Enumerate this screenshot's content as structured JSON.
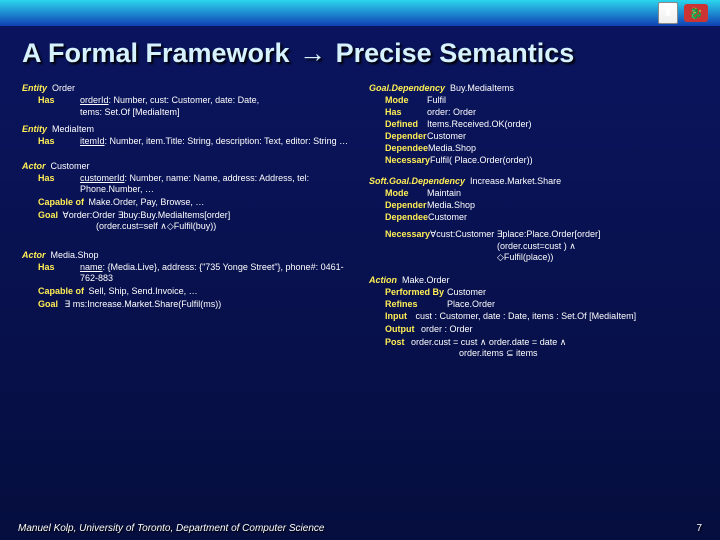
{
  "header": {
    "title_before": "A Formal Framework",
    "arrow": "→",
    "title_after": "Precise Semantics"
  },
  "left": {
    "ent1": {
      "kw": "Entity",
      "name": "Order",
      "has": "Has",
      "line1": "orderId: Number, cust: Customer, date: Date,",
      "line1_uline": "orderId",
      "line2": "tems: Set.Of [MediaItem]"
    },
    "ent2": {
      "kw": "Entity",
      "name": "MediaItem",
      "has": "Has",
      "line1": "itemId: Number, item.Title: String, description: Text, editor: String …",
      "line1_uline": "itemId"
    },
    "actor1": {
      "kw": "Actor",
      "name": "Customer",
      "has": "Has",
      "line1": "customerId: Number, name: Name, address: Address, tel: Phone.Number, …",
      "line1_uline": "customerId",
      "cap_kw": "Capable of",
      "cap_val": "Make.Order, Pay, Browse, …",
      "goal_kw": "Goal",
      "goal_val1": "∀order:Order ∃buy:Buy.MediaItems[order]",
      "goal_val2": "(order.cust=self ∧◇Fulfil(buy))"
    },
    "actor2": {
      "kw": "Actor",
      "name": "Media.Shop",
      "has": "Has",
      "line1": "name: {Media.Live}, address: {\"735 Yonge Street\"}, phone#: 0461-762-883",
      "line1_uline": "name",
      "cap_kw": "Capable of",
      "cap_val": "Sell, Ship, Send.Invoice, …",
      "goal_kw": "Goal",
      "goal_val": "∃ ms:Increase.Market.Share(Fulfil(ms))"
    }
  },
  "right": {
    "dep": {
      "kw": "Goal.Dependency",
      "name": "Buy.MediaItems",
      "rows": [
        {
          "k": "Mode",
          "v": "Fulfil"
        },
        {
          "k": "Has",
          "v": "order: Order"
        },
        {
          "k": "Defined",
          "v": "Items.Received.OK(order)"
        },
        {
          "k": "Depender",
          "v": "Customer"
        },
        {
          "k": "Dependee",
          "v": "Media.Shop"
        },
        {
          "k": "Necessary",
          "v": "Fulfil( Place.Order(order))"
        }
      ]
    },
    "soft": {
      "kw": "Soft.Goal.Dependency",
      "name": "Increase.Market.Share",
      "rows": [
        {
          "k": "Mode",
          "v": "Maintain"
        },
        {
          "k": "Depender",
          "v": "Media.Shop"
        },
        {
          "k": "Dependee",
          "v": "Customer"
        }
      ],
      "nec_kw": "Necessary",
      "nec_v1": "∀cust:Customer ∃place:Place.Order[order]",
      "nec_v2": "(order.cust=cust ) ∧",
      "nec_v3": "◇Fulfil(place))"
    },
    "action": {
      "kw": "Action",
      "name": "Make.Order",
      "rows": [
        {
          "k": "Performed By",
          "v": "Customer"
        },
        {
          "k": "Refines",
          "v": "Place.Order"
        }
      ],
      "input_kw": "Input",
      "input_v": "cust : Customer, date : Date,  items : Set.Of [MediaItem]",
      "output_kw": "Output",
      "output_v": "order : Order",
      "post_kw": "Post",
      "post_v1": "order.cust = cust ∧  order.date = date ∧",
      "post_v2": "order.items ⊆ items"
    }
  },
  "footer": {
    "text": "Manuel Kolp, University of Toronto, Department of Computer Science",
    "page": "7"
  }
}
